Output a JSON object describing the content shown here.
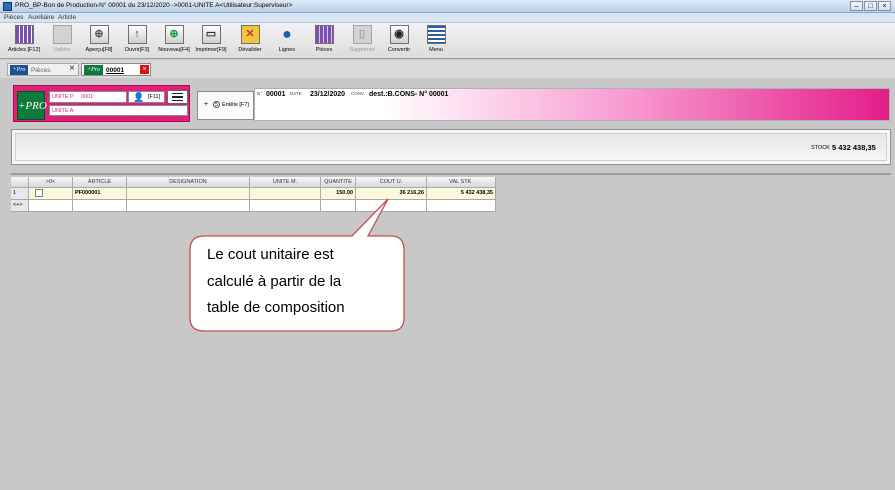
{
  "window": {
    "title": "PRO_BP-Bon de Production-N° 00001 du 23/12/2020 ->0001-UNITE A<Utilisateur:Superviseur>"
  },
  "menu": [
    "Pièces",
    "Auxiliaire",
    "Article"
  ],
  "toolbar": {
    "buttons": [
      {
        "label": "Articles [F12]",
        "icon": "articles-grid-icon",
        "enabled": true
      },
      {
        "label": "Valider",
        "icon": "validate-icon",
        "enabled": false
      },
      {
        "label": "Aperçu[F8]",
        "icon": "preview-magnifier-icon",
        "enabled": true
      },
      {
        "label": "Ouvrir[F3]",
        "icon": "open-up-arrow-icon",
        "enabled": true
      },
      {
        "label": "Nouveau[F4]",
        "icon": "new-plus-icon",
        "enabled": true
      },
      {
        "label": "Imprimer[F9]",
        "icon": "print-icon",
        "enabled": true
      },
      {
        "label": "Dévalider",
        "icon": "invalidate-x-icon",
        "enabled": true
      },
      {
        "label": "Lignes",
        "icon": "lines-search-icon",
        "enabled": true
      },
      {
        "label": "Pièces",
        "icon": "pieces-grid-icon",
        "enabled": true
      },
      {
        "label": "Supprimer",
        "icon": "delete-icon",
        "enabled": false
      },
      {
        "label": "Convertir",
        "icon": "convert-eye-icon",
        "enabled": true
      },
      {
        "label": "Menu",
        "icon": "menu-lines-icon",
        "enabled": true
      }
    ]
  },
  "tabs": [
    {
      "logo": "+Pro",
      "label": "Pièces"
    },
    {
      "logo": "+Pro",
      "label": "00001"
    }
  ],
  "header": {
    "logo": "+PRO",
    "unite_label": "UNITE P",
    "unite_code": "0001",
    "search_shortcut": "[F11]",
    "unite_name": "UNITE A",
    "entete_number": "5",
    "entete_label": "Entête [F7]",
    "doc_meta_n": "N°",
    "doc_number": "00001",
    "doc_meta_date": "DATE",
    "doc_date": "23/12/2020",
    "doc_meta_conv": "CONV",
    "doc_dest": "dest.:B.CONS- N° 00001"
  },
  "stock": {
    "label": "STOCK",
    "value": "5 432 438,35"
  },
  "grid": {
    "headers": [
      "",
      ">0<",
      "ARTICLE",
      "DESIGNATION",
      "UNITE M.",
      "QUANTITE",
      "COUT U.",
      "VAL STK."
    ],
    "rows": [
      {
        "index": "1",
        "article": "PF000001",
        "designation": "",
        "unite": "",
        "quantite": "150.00",
        "cout": "36 216,26",
        "val": "5 432 438,35"
      }
    ],
    "new_row_marker": "<+>"
  },
  "callout": {
    "lines": [
      "Le cout unitaire est",
      "calculé à partir de la",
      "table de composition"
    ],
    "border_color": "#c0504d"
  },
  "colors": {
    "accent_magenta": "#e41d7a",
    "logo_green": "#0c7a3a",
    "row_highlight": "#fbf8dc"
  }
}
